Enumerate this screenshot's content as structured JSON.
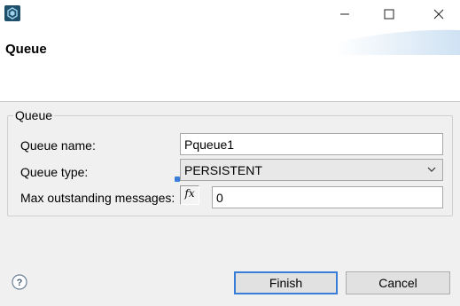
{
  "window": {
    "app_icon": "app-logo-icon",
    "controls": [
      "minimize-icon",
      "maximize-icon",
      "close-icon"
    ]
  },
  "header": {
    "title": "Queue"
  },
  "group": {
    "legend": "Queue",
    "fields": {
      "name_label": "Queue name:",
      "name_value": "Pqueue1",
      "type_label": "Queue type:",
      "type_value": "PERSISTENT",
      "max_label": "Max outstanding messages:",
      "max_value": "0",
      "fx_label": "fx"
    }
  },
  "footer": {
    "help_icon": "help-icon",
    "finish_label": "Finish",
    "cancel_label": "Cancel"
  },
  "colors": {
    "accent": "#3a7dd8",
    "dialog_bg": "#f0f0f0",
    "header_bg": "#ffffff"
  }
}
